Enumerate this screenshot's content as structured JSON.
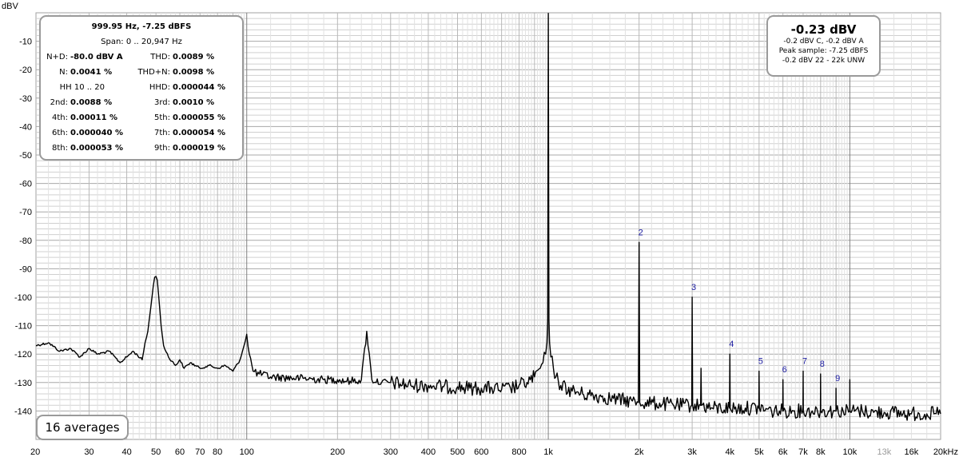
{
  "chart_data": {
    "type": "line",
    "title": "",
    "ylabel": "dBV",
    "xlabel": "",
    "xscale": "log",
    "xlim": [
      20,
      20000
    ],
    "ylim": [
      -150,
      0
    ],
    "grid": true,
    "yticks": [
      {
        "v": -10,
        "label": "-10"
      },
      {
        "v": -20,
        "label": "-20"
      },
      {
        "v": -30,
        "label": "-30"
      },
      {
        "v": -40,
        "label": "-40"
      },
      {
        "v": -50,
        "label": "-50"
      },
      {
        "v": -60,
        "label": "-60"
      },
      {
        "v": -70,
        "label": "-70"
      },
      {
        "v": -80,
        "label": "-80"
      },
      {
        "v": -90,
        "label": "-90"
      },
      {
        "v": -100,
        "label": "-100"
      },
      {
        "v": -110,
        "label": "-110"
      },
      {
        "v": -120,
        "label": "-120"
      },
      {
        "v": -130,
        "label": "-130"
      },
      {
        "v": -140,
        "label": "-140"
      }
    ],
    "xticks": [
      {
        "v": 20,
        "label": "20"
      },
      {
        "v": 30,
        "label": "30"
      },
      {
        "v": 40,
        "label": "40"
      },
      {
        "v": 50,
        "label": "50"
      },
      {
        "v": 60,
        "label": "60"
      },
      {
        "v": 70,
        "label": "70"
      },
      {
        "v": 80,
        "label": "80"
      },
      {
        "v": 100,
        "label": "100"
      },
      {
        "v": 200,
        "label": "200"
      },
      {
        "v": 300,
        "label": "300"
      },
      {
        "v": 400,
        "label": "400"
      },
      {
        "v": 500,
        "label": "500"
      },
      {
        "v": 600,
        "label": "600"
      },
      {
        "v": 800,
        "label": "800"
      },
      {
        "v": 1000,
        "label": "1k"
      },
      {
        "v": 2000,
        "label": "2k"
      },
      {
        "v": 3000,
        "label": "3k"
      },
      {
        "v": 4000,
        "label": "4k"
      },
      {
        "v": 5000,
        "label": "5k"
      },
      {
        "v": 6000,
        "label": "6k"
      },
      {
        "v": 7000,
        "label": "7k"
      },
      {
        "v": 8000,
        "label": "8k"
      },
      {
        "v": 10000,
        "label": "10k"
      },
      {
        "v": 13000,
        "label": "13k"
      },
      {
        "v": 16000,
        "label": "16k"
      },
      {
        "v": 20000,
        "label": "20kHz"
      }
    ],
    "series": [
      {
        "color": "#000000",
        "x": [
          20,
          22,
          24,
          26,
          28,
          30,
          32,
          35,
          38,
          40,
          42,
          45,
          46,
          47,
          48,
          49,
          49.5,
          50,
          50.5,
          51,
          52,
          53,
          55,
          58,
          60,
          62,
          65,
          70,
          75,
          80,
          85,
          90,
          95,
          98,
          100,
          102,
          105,
          110,
          120,
          150,
          180,
          200,
          220,
          240,
          250,
          260,
          280,
          300,
          350,
          400,
          450,
          500,
          550,
          600,
          650,
          700,
          750,
          800,
          850,
          900,
          940,
          960,
          980,
          990,
          995,
          1000,
          1005,
          1010,
          1020,
          1040,
          1060,
          1100,
          1200,
          1300,
          1500,
          1700,
          1900,
          1990,
          2000,
          2010,
          2100,
          2400,
          2700,
          2990,
          3000,
          3010,
          3200,
          3210,
          3220,
          3500,
          3990,
          4000,
          4010,
          4500,
          4990,
          5000,
          5010,
          5500,
          5990,
          6000,
          6010,
          6500,
          6990,
          7000,
          7010,
          7500,
          7990,
          8000,
          8010,
          8500,
          8990,
          9000,
          9010,
          9500,
          9990,
          10000,
          10010,
          11000,
          12000,
          13000,
          14000,
          15000,
          16000,
          17000,
          18000,
          19000,
          20000
        ],
        "y": [
          -117,
          -116,
          -119,
          -118,
          -121,
          -118,
          -120,
          -119,
          -123,
          -121,
          -119,
          -122,
          -116,
          -112,
          -104,
          -96,
          -93,
          -92.7,
          -94,
          -99,
          -110,
          -117,
          -121,
          -124,
          -122,
          -125,
          -123,
          -125,
          -124,
          -125,
          -124,
          -126,
          -122,
          -117,
          -113,
          -120,
          -126,
          -127,
          -128,
          -128.5,
          -129,
          -129,
          -129.5,
          -129,
          -112,
          -129,
          -130,
          -130,
          -131,
          -131,
          -131.5,
          -131.5,
          -132,
          -132,
          -132,
          -132.5,
          -132,
          -131,
          -130,
          -128,
          -125,
          -123,
          -120,
          -116,
          -108,
          -0.23,
          -108,
          -116,
          -121,
          -125,
          -128,
          -131,
          -133,
          -134,
          -135,
          -136,
          -136.5,
          -137,
          -80.7,
          -137,
          -137,
          -137.5,
          -138,
          -138,
          -100,
          -138,
          -138,
          -125,
          -138,
          -139,
          -139,
          -120,
          -139,
          -139,
          -139,
          -126,
          -139,
          -140,
          -140,
          -129,
          -140,
          -140,
          -140,
          -126,
          -140,
          -140,
          -140,
          -127,
          -140,
          -140,
          -140,
          -132,
          -140,
          -140,
          -140,
          -129,
          -140,
          -140,
          -140.5,
          -140.5,
          -140.5,
          -141,
          -141,
          -141,
          -141,
          -141,
          -141
        ]
      }
    ],
    "harmonic_labels": [
      {
        "label": "2",
        "x": 2000,
        "y": -80.7
      },
      {
        "label": "3",
        "x": 3000,
        "y": -100
      },
      {
        "label": "4",
        "x": 4000,
        "y": -120
      },
      {
        "label": "5",
        "x": 5000,
        "y": -126
      },
      {
        "label": "6",
        "x": 6000,
        "y": -129
      },
      {
        "label": "7",
        "x": 7000,
        "y": -126
      },
      {
        "label": "8",
        "x": 8000,
        "y": -127
      },
      {
        "label": "9",
        "x": 9000,
        "y": -132
      }
    ]
  },
  "stats_box": {
    "header1": "999.95 Hz, -7.25 dBFS",
    "header2": "Span: 0 .. 20,947 Hz",
    "rows": [
      {
        "l1": "N+D:",
        "v1": "-80.0 dBV A",
        "l2": "THD:",
        "v2": "0.0089 %"
      },
      {
        "l1": "N:",
        "v1": "0.0041 %",
        "l2": "THD+N:",
        "v2": "0.0098 %"
      },
      {
        "l1": "HH 10 .. 20",
        "v1": "",
        "l2": "HHD:",
        "v2": "0.000044 %"
      },
      {
        "l1": "2nd:",
        "v1": "0.0088 %",
        "l2": "3rd:",
        "v2": "0.0010 %"
      },
      {
        "l1": "4th:",
        "v1": "0.00011 %",
        "l2": "5th:",
        "v2": "0.000055 %"
      },
      {
        "l1": "6th:",
        "v1": "0.000040 %",
        "l2": "7th:",
        "v2": "0.000054 %"
      },
      {
        "l1": "8th:",
        "v1": "0.000053 %",
        "l2": "9th:",
        "v2": "0.000019 %"
      }
    ]
  },
  "level_box": {
    "main": "-0.23 dBV",
    "line1": "-0.2 dBV C, -0.2 dBV A",
    "line2": "Peak sample: -7.25 dBFS",
    "line3": "-0.2 dBV 22 - 22k UNW"
  },
  "averages": "16 averages",
  "colors": {
    "trace": "#000000",
    "grid": "#d0d0d0",
    "grid_major": "#a8a8a8",
    "harmonic_label": "#1a1aa0",
    "box_border": "#9a9a9a"
  }
}
